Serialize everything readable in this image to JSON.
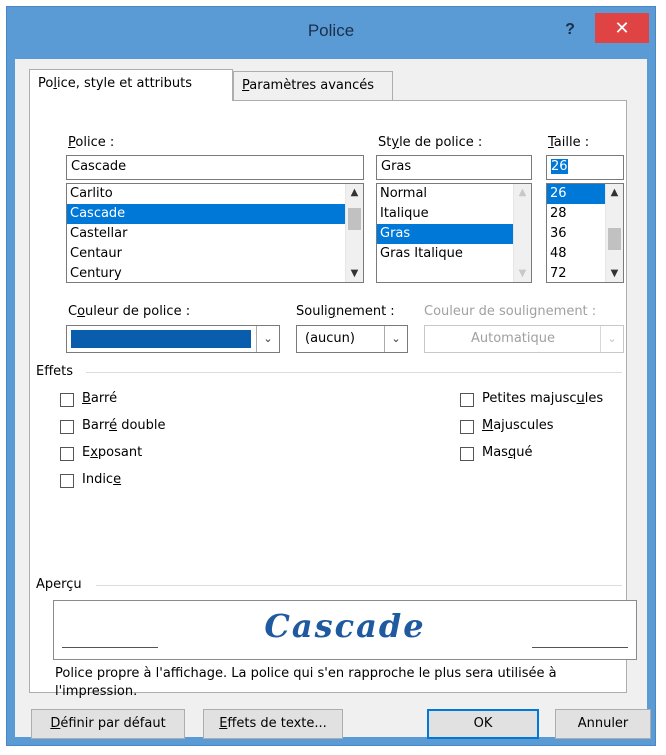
{
  "window": {
    "title": "Police",
    "help": "?",
    "close": "✕"
  },
  "tabs": [
    {
      "label_pre": "Po",
      "label_u": "l",
      "label_post": "ice, style et attributs"
    },
    {
      "label_pre": "",
      "label_u": "P",
      "label_post": "aramètres avancés"
    }
  ],
  "font": {
    "label_u": "P",
    "label_post": "olice :",
    "value": "Cascade",
    "items": [
      "Carlito",
      "Cascade",
      "Castellar",
      "Centaur",
      "Century"
    ],
    "selected": "Cascade"
  },
  "style": {
    "label_pre": "St",
    "label_u": "y",
    "label_post": "le de police :",
    "value": "Gras",
    "items": [
      "Normal",
      "Italique",
      "Gras",
      "Gras Italique"
    ],
    "selected": "Gras"
  },
  "size": {
    "label_u": "T",
    "label_post": "aille :",
    "value": "26",
    "items": [
      "26",
      "28",
      "36",
      "48",
      "72"
    ],
    "selected": "26"
  },
  "color": {
    "label_pre": "C",
    "label_u": "o",
    "label_post": "uleur de police :",
    "value_color": "#0a5cad"
  },
  "underline": {
    "label_pre": "Souli",
    "label_u": "g",
    "label_post": "nement :",
    "value": "(aucun)"
  },
  "underline_color": {
    "label": "Couleur de soulignement :",
    "value": "Automatique"
  },
  "effects": {
    "heading": "Effets",
    "left": [
      {
        "pre": "",
        "u": "B",
        "post": "arré"
      },
      {
        "pre": "Barr",
        "u": "é",
        "post": " double"
      },
      {
        "pre": "E",
        "u": "x",
        "post": "posant"
      },
      {
        "pre": "Indic",
        "u": "e",
        "post": ""
      }
    ],
    "right": [
      {
        "pre": "Petites majusc",
        "u": "u",
        "post": "les"
      },
      {
        "pre": "",
        "u": "M",
        "post": "ajuscules"
      },
      {
        "pre": "Mas",
        "u": "q",
        "post": "ué"
      }
    ]
  },
  "preview": {
    "heading": "Aperçu",
    "text": "Cascade",
    "note": "Police propre à l'affichage. La police qui s'en rapproche le plus sera utilisée à l'impression."
  },
  "buttons": {
    "default": {
      "pre": "",
      "u": "D",
      "post": "éfinir par défaut"
    },
    "text_effects": {
      "pre": "",
      "u": "E",
      "post": "ffets de texte..."
    },
    "ok": "OK",
    "cancel": "Annuler"
  }
}
